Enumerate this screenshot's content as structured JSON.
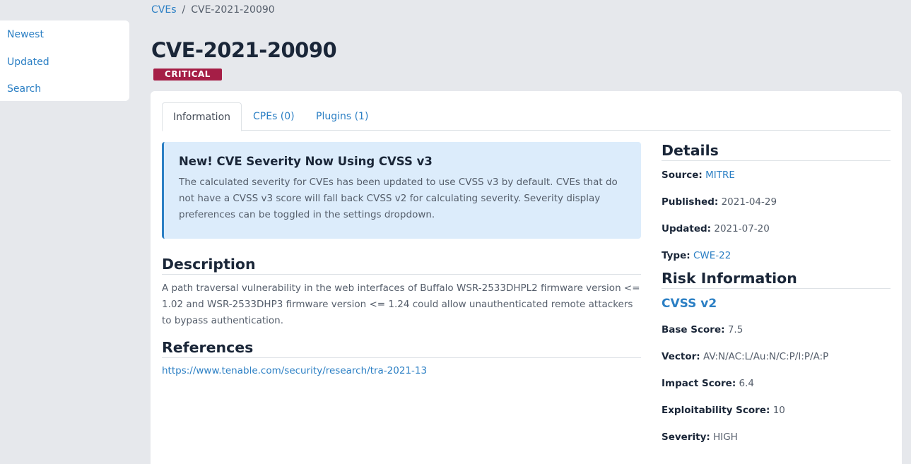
{
  "sidebar": {
    "items": [
      {
        "label": "Newest"
      },
      {
        "label": "Updated"
      },
      {
        "label": "Search"
      }
    ]
  },
  "breadcrumb": {
    "root": "CVEs",
    "separator": "/",
    "current": "CVE-2021-20090"
  },
  "page": {
    "title": "CVE-2021-20090",
    "severity_badge": "CRITICAL"
  },
  "tabs": [
    {
      "label": "Information",
      "active": true
    },
    {
      "label": "CPEs (0)",
      "active": false
    },
    {
      "label": "Plugins (1)",
      "active": false
    }
  ],
  "notice": {
    "title": "New! CVE Severity Now Using CVSS v3",
    "body": "The calculated severity for CVEs has been updated to use CVSS v3 by default. CVEs that do not have a CVSS v3 score will fall back CVSS v2 for calculating severity. Severity display preferences can be toggled in the settings dropdown."
  },
  "description": {
    "heading": "Description",
    "text": "A path traversal vulnerability in the web interfaces of Buffalo WSR-2533DHPL2 firmware version <= 1.02 and WSR-2533DHP3 firmware version <= 1.24 could allow unauthenticated remote attackers to bypass authentication."
  },
  "references": {
    "heading": "References",
    "links": [
      "https://www.tenable.com/security/research/tra-2021-13"
    ]
  },
  "details": {
    "heading": "Details",
    "source_label": "Source:",
    "source_value": "MITRE",
    "published_label": "Published:",
    "published_value": "2021-04-29",
    "updated_label": "Updated:",
    "updated_value": "2021-07-20",
    "type_label": "Type:",
    "type_value": "CWE-22"
  },
  "risk": {
    "heading": "Risk Information",
    "cvss_heading": "CVSS v2",
    "base_score_label": "Base Score:",
    "base_score_value": "7.5",
    "vector_label": "Vector:",
    "vector_value": "AV:N/AC:L/Au:N/C:P/I:P/A:P",
    "impact_label": "Impact Score:",
    "impact_value": "6.4",
    "exploitability_label": "Exploitability Score:",
    "exploitability_value": "10",
    "severity_label": "Severity:",
    "severity_value": "HIGH"
  },
  "colors": {
    "accent": "#2b7fc4",
    "critical": "#a51e46",
    "notice_bg": "#dcecfb"
  }
}
